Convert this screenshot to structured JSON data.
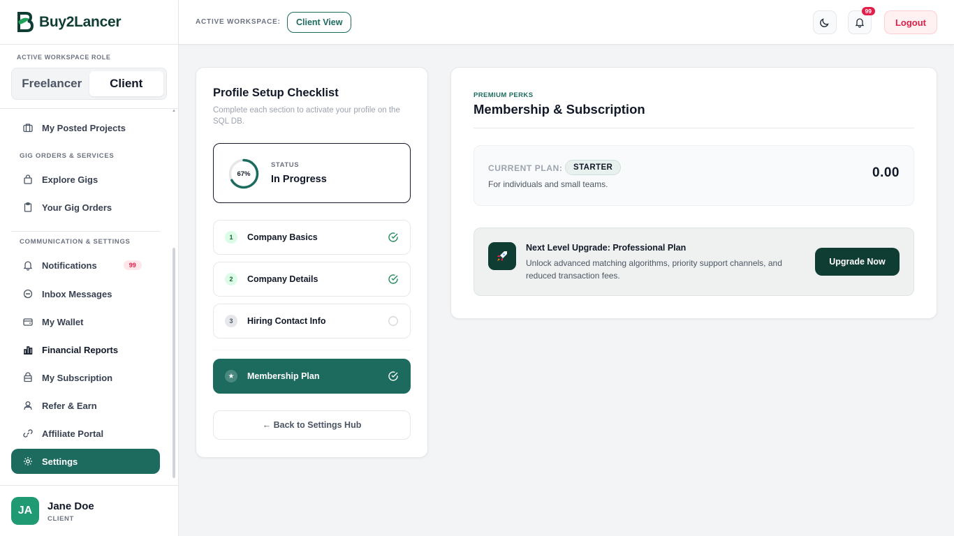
{
  "brand": {
    "name": "Buy2Lancer"
  },
  "sidebar": {
    "role_label": "ACTIVE WORKSPACE ROLE",
    "roles": [
      "Freelancer",
      "Client"
    ],
    "items_top": [
      {
        "label": "My Posted Projects"
      }
    ],
    "section_gigs": "GIG ORDERS & SERVICES",
    "items_gigs": [
      {
        "label": "Explore Gigs"
      },
      {
        "label": "Your Gig Orders"
      }
    ],
    "section_comm": "COMMUNICATION & SETTINGS",
    "items_comm": [
      {
        "label": "Notifications",
        "badge": "99"
      },
      {
        "label": "Inbox Messages"
      },
      {
        "label": "My Wallet"
      },
      {
        "label": "Financial Reports"
      },
      {
        "label": "My Subscription"
      },
      {
        "label": "Refer & Earn"
      },
      {
        "label": "Affiliate Portal"
      },
      {
        "label": "Settings"
      }
    ],
    "user": {
      "initials": "JA",
      "name": "Jane Doe",
      "role": "CLIENT"
    }
  },
  "header": {
    "workspace_label": "ACTIVE WORKSPACE:",
    "workspace_value": "Client View",
    "notif_count": "99",
    "logout_label": "Logout"
  },
  "checklist": {
    "title": "Profile Setup Checklist",
    "subtitle": "Complete each section to activate your profile on the SQL DB.",
    "progress_percent": 67,
    "progress_label": "67%",
    "status_label": "STATUS",
    "status_value": "In Progress",
    "steps": [
      {
        "num": "1",
        "label": "Company Basics",
        "done": true
      },
      {
        "num": "2",
        "label": "Company Details",
        "done": true
      },
      {
        "num": "3",
        "label": "Hiring Contact Info",
        "done": false
      }
    ],
    "membership_step": {
      "icon": "★",
      "label": "Membership Plan",
      "done": true
    },
    "back_label": "← Back to Settings Hub"
  },
  "membership": {
    "eyebrow": "PREMIUM PERKS",
    "title": "Membership & Subscription",
    "plan_label": "CURRENT PLAN:",
    "plan_name": "STARTER",
    "plan_desc": "For individuals and small teams.",
    "plan_price": "0.00",
    "upgrade_title": "Next Level Upgrade: Professional Plan",
    "upgrade_desc": "Unlock advanced matching algorithms, priority support channels, and reduced transaction fees.",
    "upgrade_button": "Upgrade Now"
  },
  "colors": {
    "accent": "#1d6b5f",
    "brand_dark": "#0f3d33",
    "danger": "#e11d48"
  }
}
